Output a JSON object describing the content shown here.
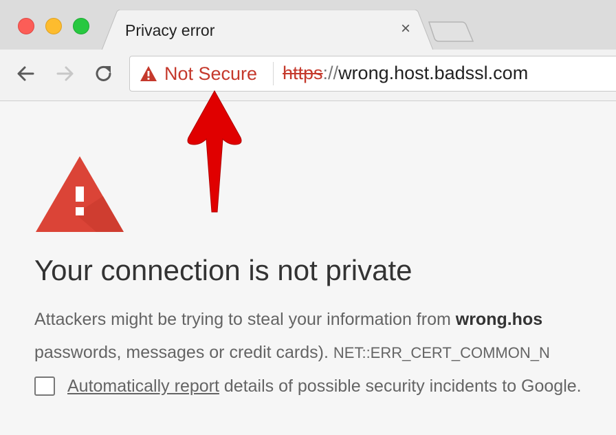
{
  "window": {
    "tab_title": "Privacy error",
    "close_glyph": "×"
  },
  "toolbar": {
    "security_label": "Not Secure",
    "url_scheme": "https",
    "url_separator": "://",
    "url_host": "wrong.host.badssl.com"
  },
  "page": {
    "heading": "Your connection is not private",
    "line1_text": "Attackers might be trying to steal your information from ",
    "line1_host": "wrong.hos",
    "line2_text": "passwords, messages or credit cards). ",
    "error_code": "NET::ERR_CERT_COMMON_N",
    "report_link": "Automatically report",
    "report_text": " details of possible security incidents to Google."
  },
  "colors": {
    "danger": "#c5392c",
    "warning_icon": "#db4437",
    "arrow": "#e00000"
  },
  "icons": [
    "back-arrow-icon",
    "forward-arrow-icon",
    "reload-icon",
    "warning-triangle-icon",
    "red-pointer-arrow"
  ]
}
